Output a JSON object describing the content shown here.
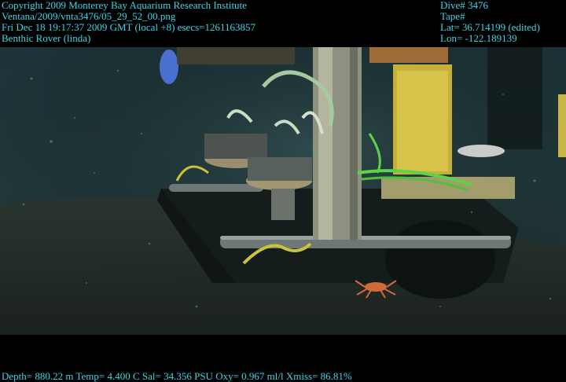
{
  "overlay_top_left": [
    "Copyright 2009 Monterey Bay Aquarium Research Institute",
    "Ventana/2009/vnta3476/05_29_52_00.png",
    "Fri Dec 18 19:17:37 2009 GMT (local +8)  esecs=1261163857",
    "Benthic Rover (linda)"
  ],
  "overlay_top_right": [
    "Dive# 3476",
    "Tape#",
    "Lat= 36.714199 (edited)",
    "Lon= -122.189139"
  ],
  "overlay_bottom": "Depth= 880.22 m  Temp= 4.400 C  Sal= 34.356 PSU  Oxy= 0.967 ml/l  Xmiss= 86.81%",
  "colors": {
    "overlay_text": "#38d6e6",
    "water": "#1f3a3e",
    "seafloor": "#2a3330",
    "frame": "#000000"
  }
}
